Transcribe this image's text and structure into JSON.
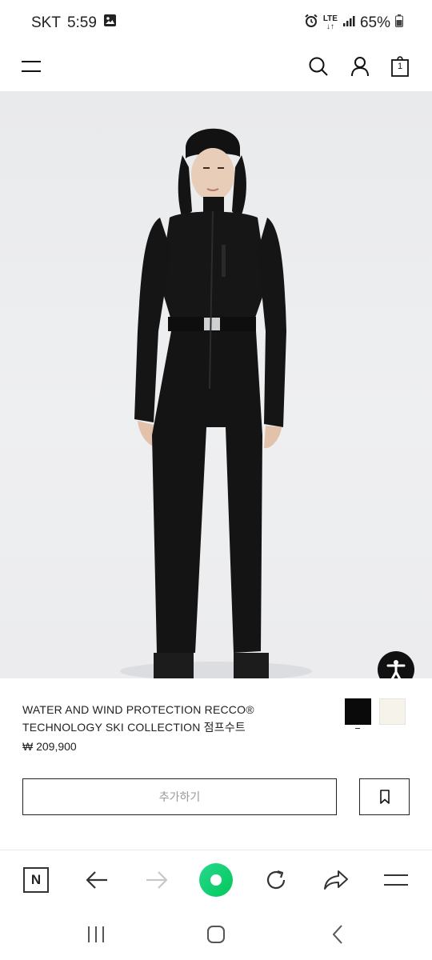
{
  "status_bar": {
    "carrier": "SKT",
    "time": "5:59",
    "network": "LTE",
    "battery": "65%"
  },
  "header": {
    "cart_count": "1"
  },
  "product": {
    "name_line1": "WATER AND WIND PROTECTION RECCO®",
    "name_line2": "TECHNOLOGY SKI COLLECTION 점프수트",
    "price": "₩ 209,900",
    "add_label": "추가하기",
    "colors": [
      "#0a0a0a",
      "#f6f3ea"
    ]
  },
  "browser": {
    "home_letter": "N"
  }
}
